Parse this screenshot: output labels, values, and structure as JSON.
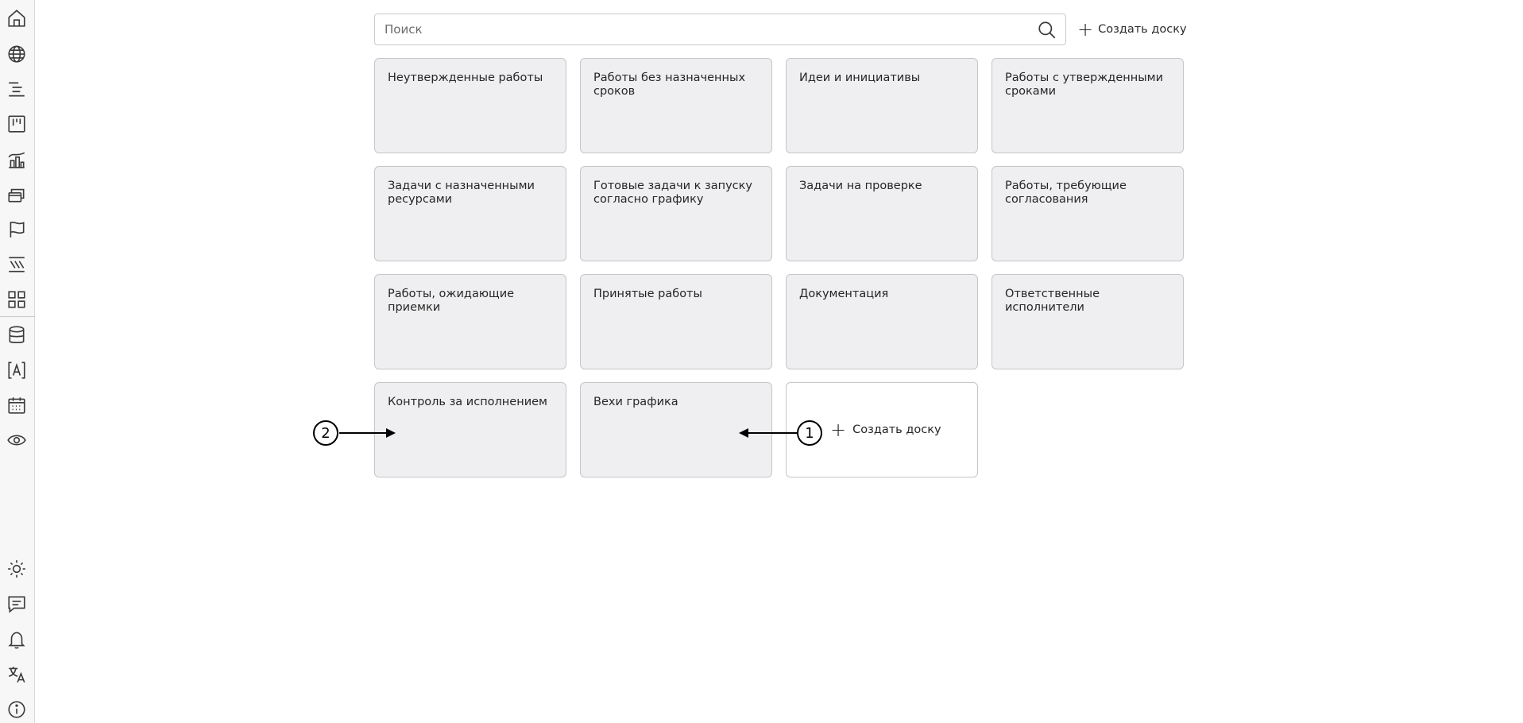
{
  "sidebar": {
    "top_icons": [
      "home-icon",
      "globe-icon",
      "list-tree-icon",
      "kanban-icon",
      "analytics-icon",
      "layers-icon",
      "flag-icon",
      "timeline-icon",
      "grid-icon"
    ],
    "middle_icons": [
      "database-icon",
      "text-variable-icon",
      "calendar-icon",
      "eye-icon"
    ],
    "bottom_icons": [
      "sun-icon",
      "chat-icon",
      "bell-icon",
      "translate-icon",
      "info-icon"
    ]
  },
  "search": {
    "placeholder": "Поиск",
    "value": ""
  },
  "toolbar": {
    "create_board_label": "Создать доску"
  },
  "boards": [
    {
      "title": "Неутвержденные работы"
    },
    {
      "title": "Работы без назначенных сроков"
    },
    {
      "title": "Идеи и инициативы"
    },
    {
      "title": "Работы с утвержденными сроками"
    },
    {
      "title": "Задачи с назначенными ресурсами"
    },
    {
      "title": "Готовые задачи к запуску согласно графику"
    },
    {
      "title": "Задачи на проверке"
    },
    {
      "title": "Работы, требующие согласования"
    },
    {
      "title": "Работы, ожидающие приемки"
    },
    {
      "title": "Принятые работы"
    },
    {
      "title": "Документация"
    },
    {
      "title": "Ответственные исполнители"
    },
    {
      "title": "Контроль за исполнением"
    },
    {
      "title": "Вехи графика"
    }
  ],
  "new_board": {
    "label": "Создать доску"
  },
  "callouts": {
    "one": "1",
    "two": "2"
  },
  "colors": {
    "card_bg": "#efeff1",
    "card_border": "#c6c6ca",
    "sidebar_bg": "#f7f7f8",
    "icon_stroke": "#3a3a3a"
  }
}
